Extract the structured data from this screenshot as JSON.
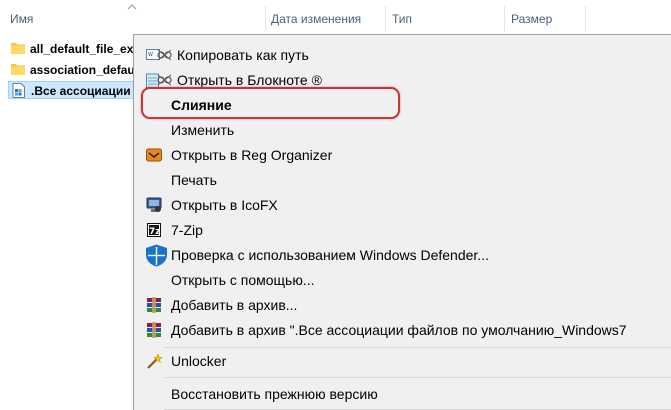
{
  "columns": {
    "name": "Имя",
    "date": "Дата изменения",
    "type": "Тип",
    "size": "Размер"
  },
  "files": [
    {
      "name": "all_default_file_ext",
      "icon": "folder-icon",
      "selected": false
    },
    {
      "name": "association_default",
      "icon": "folder-icon",
      "selected": false
    },
    {
      "name": ".Все ассоциации ф",
      "icon": "reg-file-icon",
      "selected": true
    }
  ],
  "menu": {
    "copy_path": "Копировать как путь",
    "open_notepad": "Открыть в Блокноте ®",
    "merge": "Слияние",
    "edit": "Изменить",
    "open_reg_organizer": "Открыть в Reg Organizer",
    "print": "Печать",
    "open_icofx": "Открыть в IcoFX",
    "seven_zip": "7-Zip",
    "defender": "Проверка с использованием Windows Defender...",
    "open_with": "Открыть с помощью...",
    "add_archive": "Добавить в архив...",
    "add_archive_named": "Добавить в архив \".Все ассоциации файлов по умолчанию_Windows7",
    "unlocker": "Unlocker",
    "restore": "Восстановить прежнюю версию"
  },
  "colors": {
    "highlight_ring": "#c8343b",
    "selection_bg": "#cce8ff",
    "menu_bg": "#f0f0f0",
    "defender_blue": "#1a73c9"
  }
}
